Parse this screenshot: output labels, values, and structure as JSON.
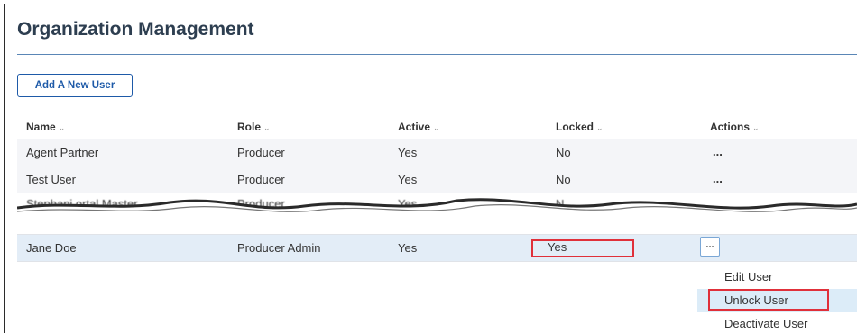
{
  "header": {
    "title": "Organization Management"
  },
  "toolbar": {
    "add_user_label": "Add A New User"
  },
  "table": {
    "columns": [
      "Name",
      "Role",
      "Active",
      "Locked",
      "Actions"
    ],
    "sort_icon": "chevron-down-icon",
    "rows": [
      {
        "name": "Agent Partner",
        "role": "Producer",
        "active": "Yes",
        "locked": "No",
        "actions": "..."
      },
      {
        "name": "Test User",
        "role": "Producer",
        "active": "Yes",
        "locked": "No",
        "actions": "..."
      },
      {
        "name": "Stephani  ortal Master",
        "role": "Producer",
        "active": "Yes",
        "locked": "N",
        "actions": "..."
      },
      {
        "name": "Jane Doe",
        "role": "Producer Admin",
        "active": "Yes",
        "locked": "Yes",
        "actions": "..."
      }
    ]
  },
  "action_menu": {
    "items": [
      "Edit User",
      "Unlock User",
      "Deactivate User"
    ],
    "highlighted": "Unlock User"
  },
  "colors": {
    "title": "#2d3e50",
    "accent": "#1e5aa8",
    "highlight_box": "#e0303a",
    "selected_row": "#e3edf7"
  }
}
